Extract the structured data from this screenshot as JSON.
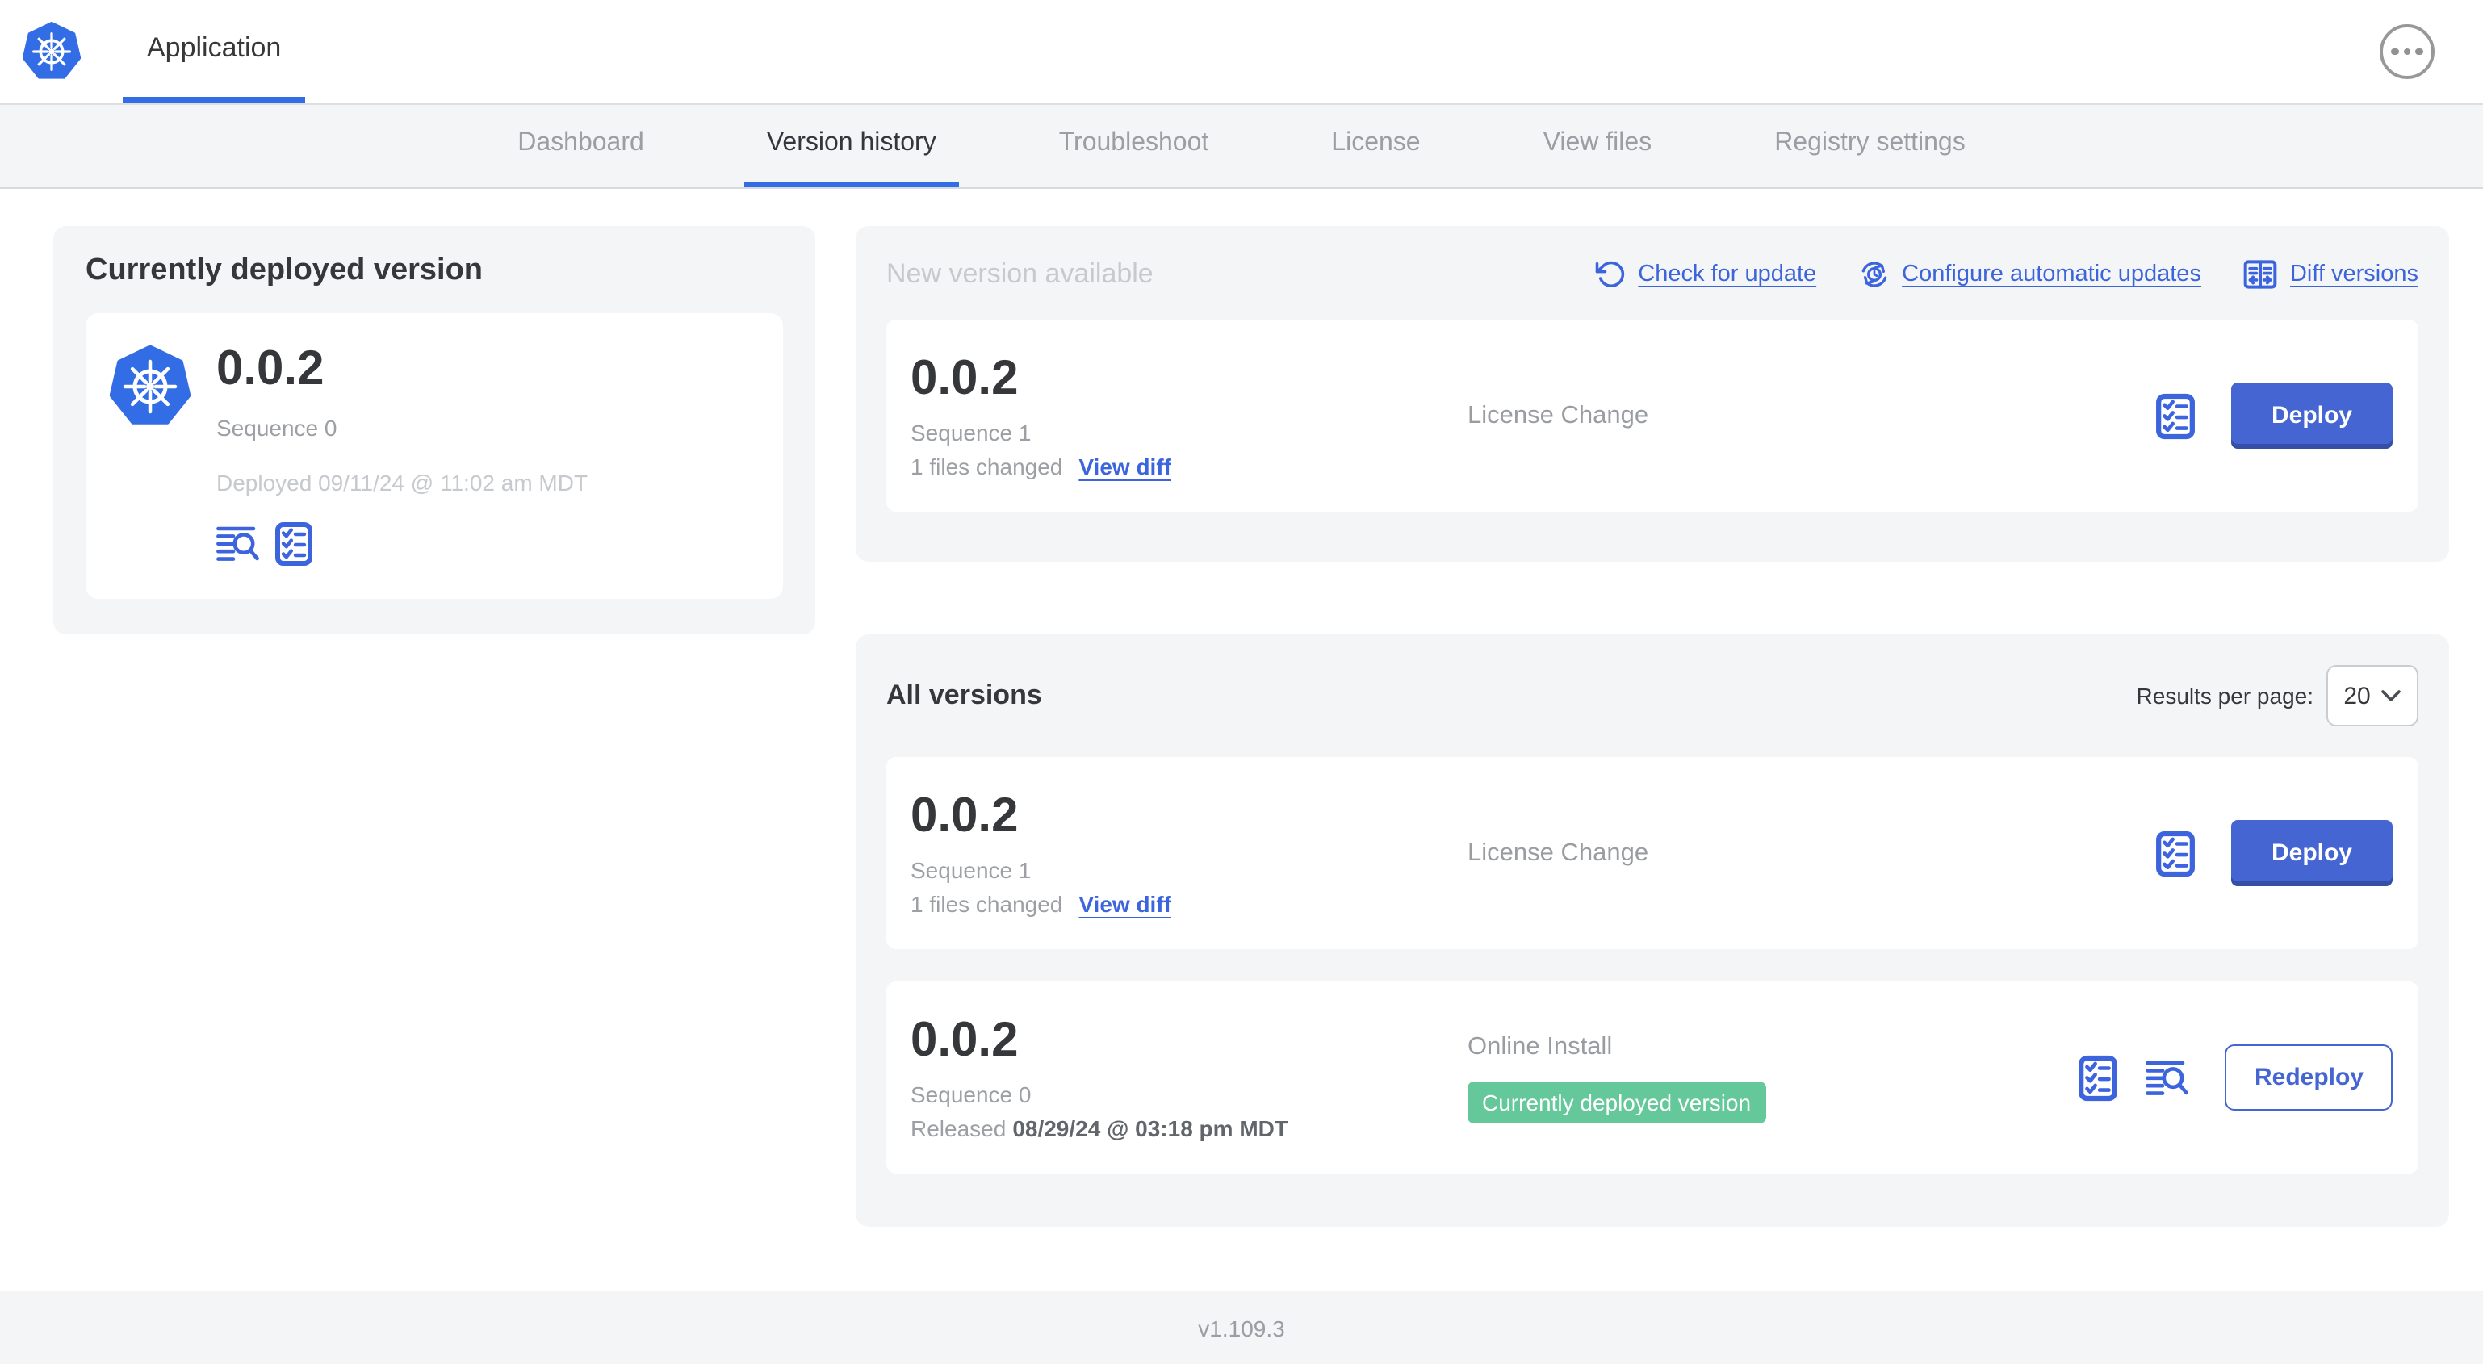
{
  "header": {
    "app_tab_label": "Application"
  },
  "nav": {
    "tabs": [
      {
        "label": "Dashboard",
        "active": false
      },
      {
        "label": "Version history",
        "active": true
      },
      {
        "label": "Troubleshoot",
        "active": false
      },
      {
        "label": "License",
        "active": false
      },
      {
        "label": "View files",
        "active": false
      },
      {
        "label": "Registry settings",
        "active": false
      }
    ]
  },
  "current_deployed": {
    "title": "Currently deployed version",
    "version": "0.0.2",
    "sequence": "Sequence 0",
    "deployed_at": "Deployed 09/11/24 @ 11:02 am MDT"
  },
  "new_version": {
    "title": "New version available",
    "actions": {
      "check_for_update": "Check for update",
      "configure_auto_updates": "Configure automatic updates",
      "diff_versions": "Diff versions"
    },
    "card": {
      "version": "0.0.2",
      "sequence": "Sequence 1",
      "files_changed": "1 files changed",
      "view_diff_label": "View diff",
      "source": "License Change",
      "deploy_label": "Deploy"
    }
  },
  "all_versions": {
    "title": "All versions",
    "results_per_page_label": "Results per page:",
    "results_per_page_value": "20",
    "rows": [
      {
        "version": "0.0.2",
        "sequence": "Sequence 1",
        "files_changed": "1 files changed",
        "view_diff_label": "View diff",
        "source": "License Change",
        "action_label": "Deploy"
      },
      {
        "version": "0.0.2",
        "sequence": "Sequence 0",
        "released_prefix": "Released",
        "released_date": "08/29/24 @ 03:18 pm MDT",
        "source": "Online Install",
        "badge": "Currently deployed version",
        "action_label": "Redeploy"
      }
    ]
  },
  "footer": {
    "app_version": "v1.109.3"
  },
  "icons": {
    "app-logo": "kubernetes-helm-wheel",
    "more-options": "ellipsis-in-circle",
    "check-for-update": "rotate-ccw-arrow",
    "configure-automatic-updates": "clock-with-sync-arrows",
    "diff-versions": "split-panes-with-arrows",
    "deploy-logs": "text-lines-with-magnifier",
    "preflight-checks": "checklist-clipboard",
    "results-per-page": "chevron-down"
  },
  "colors": {
    "kubernetes_blue": "#326de6",
    "link_blue": "#3c64dc",
    "button_blue": "#4565d2",
    "badge_green": "#65c89b",
    "panel_gray": "#f4f5f7"
  }
}
